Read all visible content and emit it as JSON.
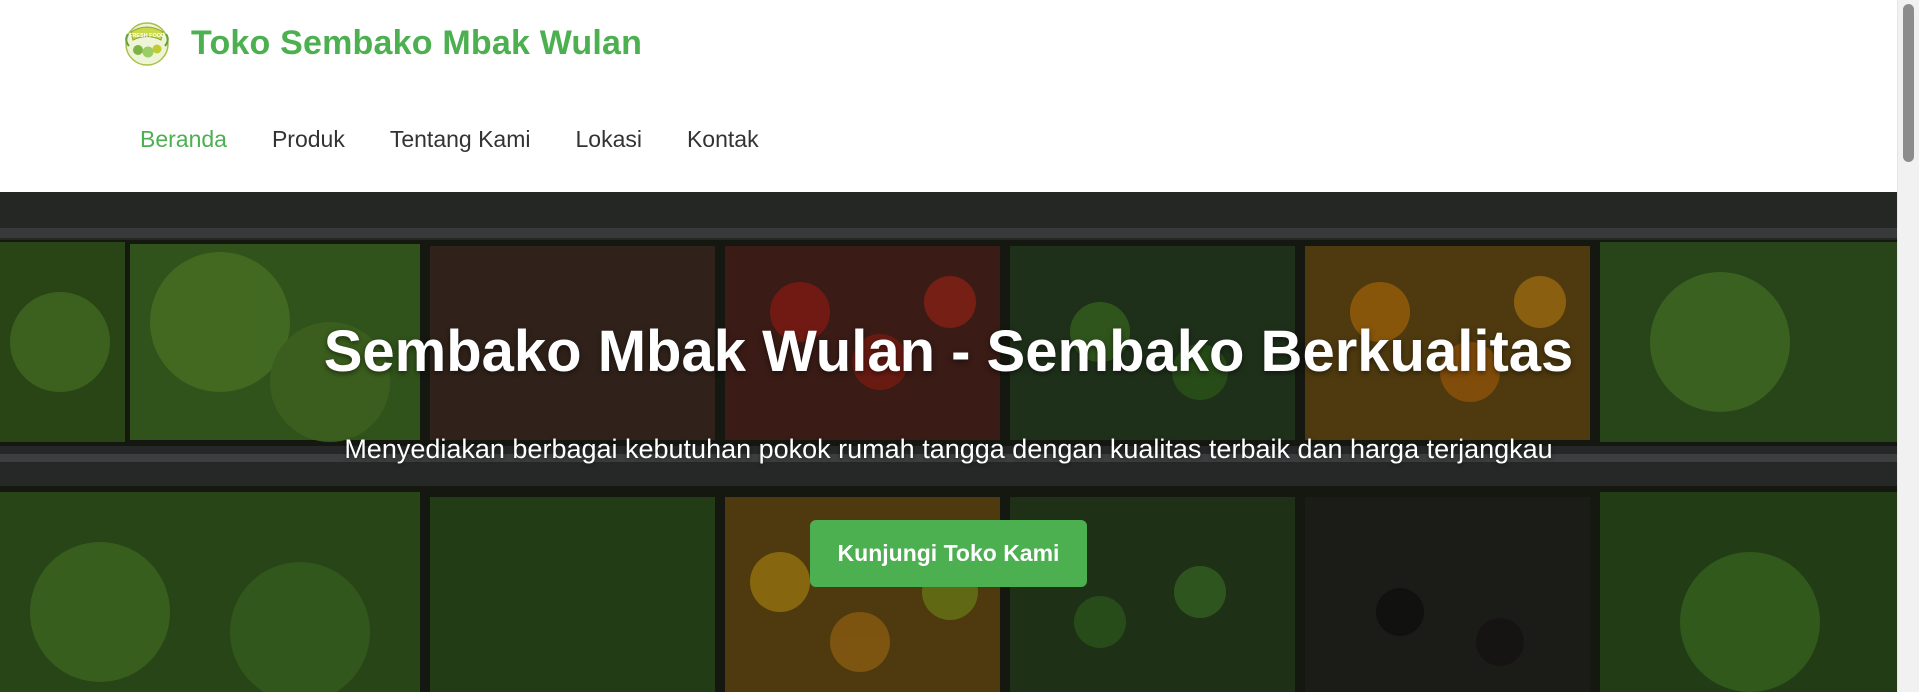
{
  "header": {
    "logo": {
      "icon": "fresh-vegetable-logo",
      "text": "FRESH FOOD"
    },
    "brand_name": "Toko Sembako Mbak Wulan",
    "nav": [
      {
        "label": "Beranda",
        "active": true
      },
      {
        "label": "Produk",
        "active": false
      },
      {
        "label": "Tentang Kami",
        "active": false
      },
      {
        "label": "Lokasi",
        "active": false
      },
      {
        "label": "Kontak",
        "active": false
      }
    ]
  },
  "hero": {
    "background": "market-vegetable-shelves-photo",
    "title": "Sembako Mbak Wulan - Sembako Berkualitas",
    "subtitle": "Menyediakan berbagai kebutuhan pokok rumah tangga dengan kualitas terbaik dan harga terjangkau",
    "cta_label": "Kunjungi Toko Kami"
  },
  "colors": {
    "accent": "#4caf50",
    "nav_text": "#333333",
    "hero_text": "#ffffff"
  }
}
